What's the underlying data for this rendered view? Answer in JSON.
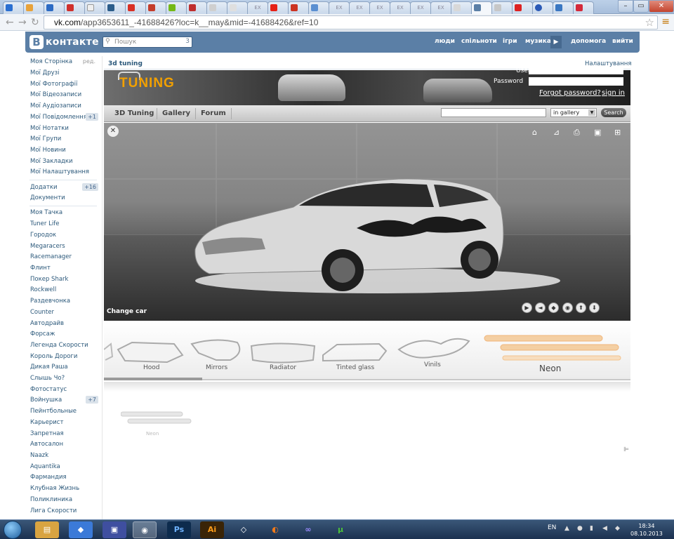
{
  "browser": {
    "url_host": "vk.com",
    "url_path": "/app3653611_-41688426?loc=k__may&mid=-41688426&ref=10",
    "tabs": [
      "EX",
      "EX",
      "EX",
      "EX",
      "EX",
      "EX",
      "EX"
    ],
    "window_controls": [
      "–",
      "▭",
      "✕"
    ]
  },
  "vk": {
    "logo_letter": "В",
    "logo_text": "контакте",
    "search_placeholder": "Пошук",
    "search_count": "3",
    "top_nav": [
      "люди",
      "спільноти",
      "ігри",
      "музика",
      "допомога",
      "вийти"
    ],
    "colors": {
      "header": "#5b7fa6",
      "link": "#2b587a"
    }
  },
  "sidebar": {
    "edit_label": "ред.",
    "items": [
      {
        "label": "Моя Сторінка"
      },
      {
        "label": "Мої Друзі"
      },
      {
        "label": "Мої Фотографії"
      },
      {
        "label": "Мої Відеозаписи"
      },
      {
        "label": "Мої Аудіозаписи"
      },
      {
        "label": "Мої Повідомлення",
        "badge": "+1"
      },
      {
        "label": "Мої Нотатки"
      },
      {
        "label": "Мої Групи"
      },
      {
        "label": "Мої Новини"
      },
      {
        "label": "Мої Закладки"
      },
      {
        "label": "Мої Налаштування"
      }
    ],
    "apps": [
      {
        "label": "Додатки",
        "badge": "+16"
      },
      {
        "label": "Документи"
      }
    ],
    "games": [
      {
        "label": "Моя Тачка"
      },
      {
        "label": "Tuner Life"
      },
      {
        "label": "Городок"
      },
      {
        "label": "Megaracers"
      },
      {
        "label": "Racemanager"
      },
      {
        "label": "Флинт"
      },
      {
        "label": "Покер Shark"
      },
      {
        "label": "Rockwell"
      },
      {
        "label": "Раздевчонка"
      },
      {
        "label": "Counter"
      },
      {
        "label": "Автодрайв"
      },
      {
        "label": "Форсаж"
      },
      {
        "label": "Легенда Скорости"
      },
      {
        "label": "Король Дороги"
      },
      {
        "label": "Дикая Раша"
      },
      {
        "label": "Слышь Чо?"
      },
      {
        "label": "Фотостатус"
      },
      {
        "label": "Войнушка",
        "badge": "+7"
      },
      {
        "label": "Пейнтбольные"
      },
      {
        "label": "Карьерист"
      },
      {
        "label": "Запретная"
      },
      {
        "label": "Автосалон"
      },
      {
        "label": "Naazk"
      },
      {
        "label": "Aquantika"
      },
      {
        "label": "Фармандия"
      },
      {
        "label": "Клубная Жизнь"
      },
      {
        "label": "Поликлиника"
      },
      {
        "label": "Лига Скорости"
      }
    ]
  },
  "app": {
    "title": "3d tuning",
    "settings": "Налаштування",
    "banner_logo": "TUNING",
    "user_label": "User",
    "password_label": "Password",
    "forgot": "Forgot password?",
    "signin": "sign in",
    "nav": [
      "3D Tuning",
      "Gallery",
      "Forum"
    ],
    "gallery_select": "in gallery",
    "search_button": "Search",
    "change_car": "Change car",
    "viewer_icons": [
      "home-icon",
      "ruler-icon",
      "print-icon",
      "camera-icon",
      "sitemap-icon"
    ],
    "controls": [
      "▶",
      "◄",
      "◆",
      "◉",
      "⬆",
      "⬇"
    ],
    "parts": [
      "Hood",
      "Mirrors",
      "Radiator",
      "Tinted glass",
      "Vinils",
      "Neon"
    ],
    "neon_thumb_label": "Neon"
  },
  "taskbar": {
    "lang": "EN",
    "time": "18:34",
    "date": "08.10.2013"
  }
}
